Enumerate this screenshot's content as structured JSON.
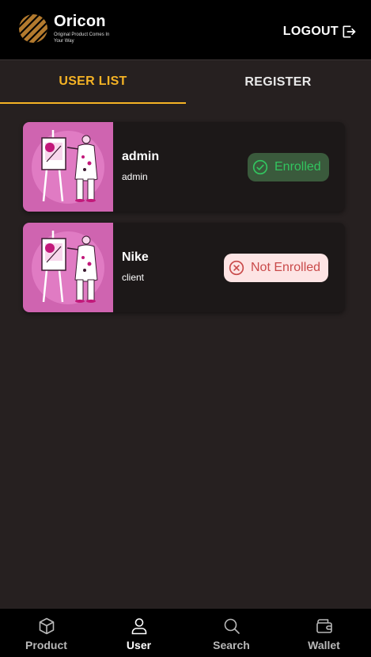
{
  "header": {
    "brand": "Oricon",
    "tagline": "Original Product Comes In Your Way",
    "logout_label": "LOGOUT",
    "logout_icon": "logout-icon"
  },
  "tabs": [
    {
      "label": "USER LIST",
      "active": true
    },
    {
      "label": "REGISTER",
      "active": false
    }
  ],
  "users": [
    {
      "name": "admin",
      "role": "admin",
      "status": "Enrolled",
      "status_icon": "check-circle-icon"
    },
    {
      "name": "Nike",
      "role": "client",
      "status": "Not Enrolled",
      "status_icon": "x-circle-icon"
    }
  ],
  "bottom_nav": [
    {
      "label": "Product",
      "icon": "cube-icon",
      "active": false
    },
    {
      "label": "User",
      "icon": "user-icon",
      "active": true
    },
    {
      "label": "Search",
      "icon": "search-icon",
      "active": false
    },
    {
      "label": "Wallet",
      "icon": "wallet-icon",
      "active": false
    }
  ],
  "colors": {
    "accent": "#f5b325",
    "background": "#262020",
    "card": "#1c1818",
    "enrolled_bg": "#3a5a3c",
    "enrolled_text": "#32c55f",
    "not_enrolled_bg": "#fde4e4",
    "not_enrolled_text": "#c94a4a",
    "avatar_bg": "#cf64b0"
  }
}
